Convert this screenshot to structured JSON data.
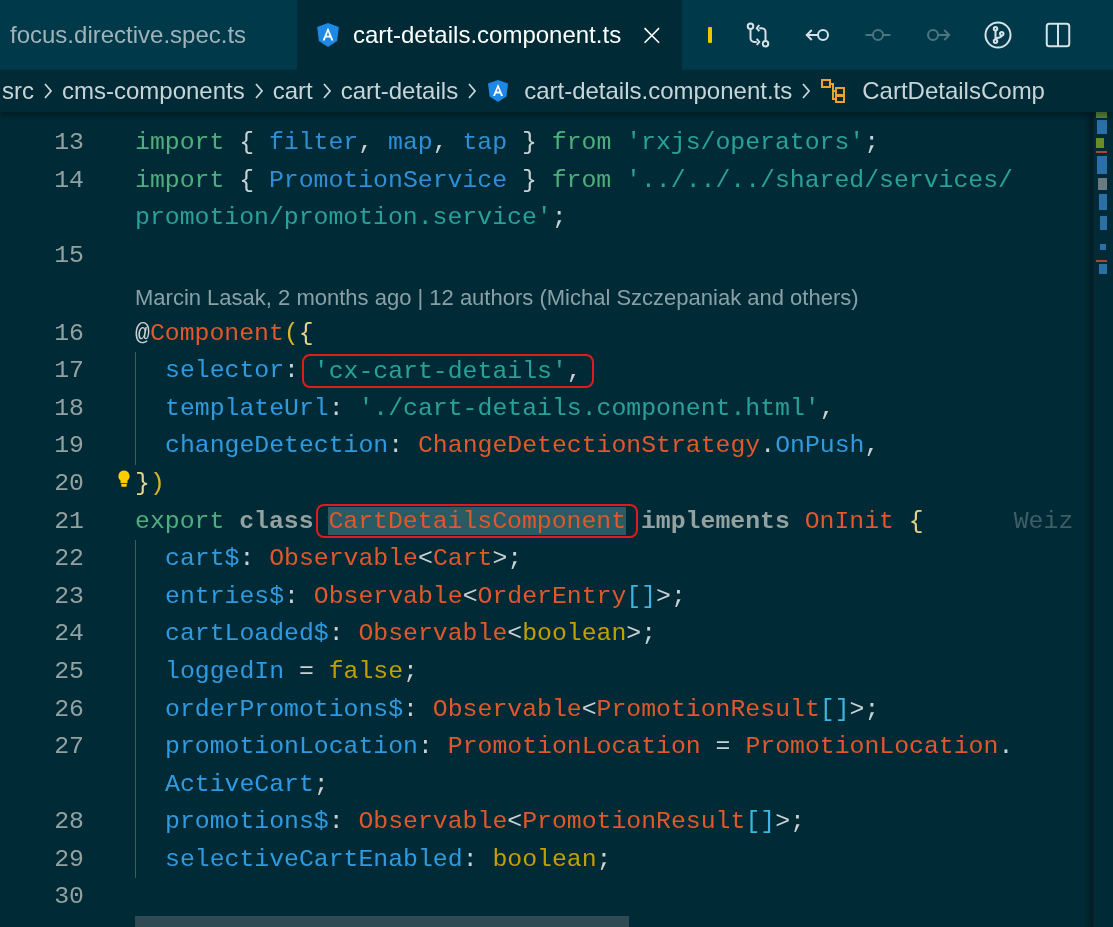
{
  "tabs": [
    {
      "label": "focus.directive.spec.ts",
      "selected": false,
      "kind": "plain"
    },
    {
      "label": "cart-details.component.ts",
      "selected": true,
      "kind": "angular",
      "close": "×"
    }
  ],
  "toolbar": [
    {
      "kind": "marker",
      "disabled": false
    },
    {
      "kind": "compare",
      "disabled": false
    },
    {
      "kind": "prev",
      "disabled": false
    },
    {
      "kind": "commit",
      "disabled": true
    },
    {
      "kind": "next",
      "disabled": true
    },
    {
      "kind": "branch",
      "disabled": false
    },
    {
      "kind": "split",
      "disabled": false
    }
  ],
  "breadcrumb": [
    {
      "label": "src",
      "kind": "folder"
    },
    {
      "label": "cms-components",
      "kind": "folder"
    },
    {
      "label": "cart",
      "kind": "folder"
    },
    {
      "label": "cart-details",
      "kind": "folder"
    },
    {
      "label": "cart-details.component.ts",
      "kind": "angular"
    },
    {
      "label": "CartDetailsComp",
      "kind": "class"
    }
  ],
  "lines": [
    {
      "number": "13",
      "tokens": [
        {
          "text": "import",
          "kind": "kw"
        },
        {
          "text": " { ",
          "kind": "punct"
        },
        {
          "text": "filter",
          "kind": "ident"
        },
        {
          "text": ", ",
          "kind": "punct"
        },
        {
          "text": "map",
          "kind": "ident"
        },
        {
          "text": ", ",
          "kind": "punct"
        },
        {
          "text": "tap",
          "kind": "ident"
        },
        {
          "text": " } ",
          "kind": "punct"
        },
        {
          "text": "from ",
          "kind": "kw"
        },
        {
          "text": "'rxjs/operators'",
          "kind": "str"
        },
        {
          "text": ";",
          "kind": "punct"
        }
      ]
    },
    {
      "number": "14",
      "tokens": [
        {
          "text": "import",
          "kind": "kw"
        },
        {
          "text": " { ",
          "kind": "punct"
        },
        {
          "text": "PromotionService",
          "kind": "ident"
        },
        {
          "text": " } ",
          "kind": "punct"
        },
        {
          "text": "from ",
          "kind": "kw"
        },
        {
          "text": "'../../../shared/services/",
          "kind": "str"
        }
      ],
      "wrap": [
        {
          "text": "promotion/promotion.service'",
          "kind": "str"
        },
        {
          "text": ";",
          "kind": "punct"
        }
      ]
    },
    {
      "number": "15"
    },
    {
      "blame": "Marcin Lasak, 2 months ago | 12 authors (Michal Szczepaniak and others)"
    },
    {
      "number": "16",
      "tokens": [
        {
          "text": "@",
          "kind": "punct"
        },
        {
          "text": "Component",
          "kind": "type"
        },
        {
          "text": "(",
          "kind": "paren"
        },
        {
          "text": "{",
          "kind": "brace"
        }
      ]
    },
    {
      "number": "17",
      "indented": true,
      "tokens": [
        {
          "text": "selector",
          "kind": "prop"
        },
        {
          "text": ": ",
          "kind": "punct"
        },
        {
          "kind": "box",
          "tokens": [
            {
              "text": "'cx-cart-details'",
              "kind": "str"
            },
            {
              "text": ",",
              "kind": "punct"
            }
          ]
        }
      ]
    },
    {
      "number": "18",
      "indented": true,
      "tokens": [
        {
          "text": "templateUrl",
          "kind": "prop"
        },
        {
          "text": ": ",
          "kind": "punct"
        },
        {
          "text": "'./cart-details.component.html'",
          "kind": "str"
        },
        {
          "text": ",",
          "kind": "punct"
        }
      ]
    },
    {
      "number": "19",
      "indented": true,
      "tokens": [
        {
          "text": "changeDetection",
          "kind": "prop"
        },
        {
          "text": ": ",
          "kind": "punct"
        },
        {
          "text": "ChangeDetectionStrategy",
          "kind": "type"
        },
        {
          "text": ".",
          "kind": "punct"
        },
        {
          "text": "OnPush",
          "kind": "prop"
        },
        {
          "text": ",",
          "kind": "punct"
        }
      ]
    },
    {
      "number": "20",
      "lightbulb": true,
      "tokens": [
        {
          "text": "}",
          "kind": "brace"
        },
        {
          "text": ")",
          "kind": "paren"
        }
      ]
    },
    {
      "number": "21",
      "tokens": [
        {
          "text": "export ",
          "kind": "kw"
        },
        {
          "text": "class ",
          "kind": "bold"
        },
        {
          "kind": "box",
          "tokens": [
            {
              "text": "CartDetailsComponent",
              "kind": "type",
              "highlighted": true
            }
          ]
        },
        {
          "text": " implements ",
          "kind": "bold"
        },
        {
          "text": "OnInit ",
          "kind": "type"
        },
        {
          "text": "{",
          "kind": "brace"
        },
        {
          "text": "Weiz",
          "kind": "ghost"
        }
      ]
    },
    {
      "number": "22",
      "indented": true,
      "tokens": [
        {
          "text": "cart$",
          "kind": "prop"
        },
        {
          "text": ": ",
          "kind": "punct"
        },
        {
          "text": "Observable",
          "kind": "type"
        },
        {
          "text": "<",
          "kind": "punct"
        },
        {
          "text": "Cart",
          "kind": "type"
        },
        {
          "text": ">;",
          "kind": "punct"
        }
      ]
    },
    {
      "number": "23",
      "indented": true,
      "tokens": [
        {
          "text": "entries$",
          "kind": "prop"
        },
        {
          "text": ": ",
          "kind": "punct"
        },
        {
          "text": "Observable",
          "kind": "type"
        },
        {
          "text": "<",
          "kind": "punct"
        },
        {
          "text": "OrderEntry",
          "kind": "type"
        },
        {
          "text": "[]",
          "kind": "bracket"
        },
        {
          "text": ">;",
          "kind": "punct"
        }
      ]
    },
    {
      "number": "24",
      "indented": true,
      "tokens": [
        {
          "text": "cartLoaded$",
          "kind": "prop"
        },
        {
          "text": ": ",
          "kind": "punct"
        },
        {
          "text": "Observable",
          "kind": "type"
        },
        {
          "text": "<",
          "kind": "punct"
        },
        {
          "text": "boolean",
          "kind": "lit"
        },
        {
          "text": ">;",
          "kind": "punct"
        }
      ]
    },
    {
      "number": "25",
      "indented": true,
      "tokens": [
        {
          "text": "loggedIn",
          "kind": "prop"
        },
        {
          "text": " = ",
          "kind": "punct"
        },
        {
          "text": "false",
          "kind": "lit"
        },
        {
          "text": ";",
          "kind": "punct"
        }
      ]
    },
    {
      "number": "26",
      "indented": true,
      "tokens": [
        {
          "text": "orderPromotions$",
          "kind": "prop"
        },
        {
          "text": ": ",
          "kind": "punct"
        },
        {
          "text": "Observable",
          "kind": "type"
        },
        {
          "text": "<",
          "kind": "punct"
        },
        {
          "text": "PromotionResult",
          "kind": "type"
        },
        {
          "text": "[]",
          "kind": "bracket"
        },
        {
          "text": ">;",
          "kind": "punct"
        }
      ]
    },
    {
      "number": "27",
      "indented": true,
      "tokens": [
        {
          "text": "promotionLocation",
          "kind": "prop"
        },
        {
          "text": ": ",
          "kind": "punct"
        },
        {
          "text": "PromotionLocation",
          "kind": "type"
        },
        {
          "text": " = ",
          "kind": "punct"
        },
        {
          "text": "PromotionLocation",
          "kind": "type"
        },
        {
          "text": ".",
          "kind": "punct"
        }
      ],
      "wrap": [
        {
          "text": "ActiveCart",
          "kind": "prop"
        },
        {
          "text": ";",
          "kind": "punct"
        }
      ]
    },
    {
      "number": "28",
      "indented": true,
      "tokens": [
        {
          "text": "promotions$",
          "kind": "prop"
        },
        {
          "text": ": ",
          "kind": "punct"
        },
        {
          "text": "Observable",
          "kind": "type"
        },
        {
          "text": "<",
          "kind": "punct"
        },
        {
          "text": "PromotionResult",
          "kind": "type"
        },
        {
          "text": "[]",
          "kind": "bracket"
        },
        {
          "text": ">;",
          "kind": "punct"
        }
      ]
    },
    {
      "number": "29",
      "indented": true,
      "tokens": [
        {
          "text": "selectiveCartEnabled",
          "kind": "prop"
        },
        {
          "text": ": ",
          "kind": "punct"
        },
        {
          "text": "boolean",
          "kind": "lit"
        },
        {
          "text": ";",
          "kind": "punct"
        }
      ]
    },
    {
      "number": "30"
    }
  ]
}
